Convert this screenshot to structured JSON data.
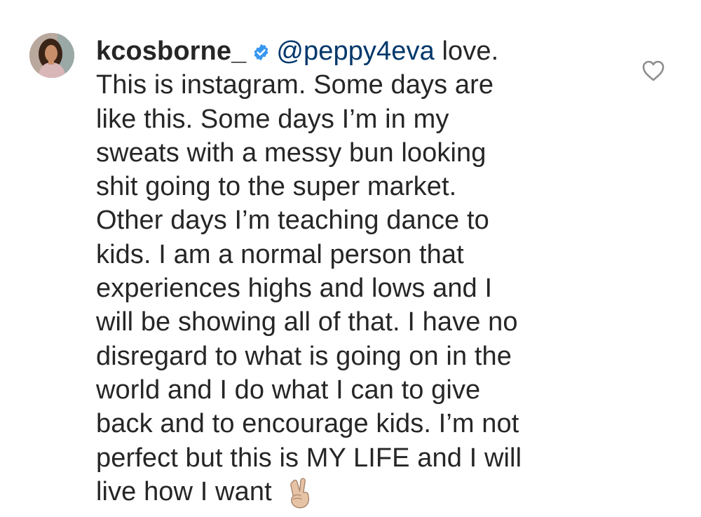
{
  "comment": {
    "avatar_icon": "profile-photo-avatar",
    "username": "kcosborne_",
    "verified_icon": "verified-badge-icon",
    "mention": "@peppy4eva",
    "first_line_rest": " love.",
    "lines": [
      "This is instagram. Some days are",
      "like this. Some days I’m in my",
      "sweats with a messy bun looking",
      "shit going to the super market.",
      "Other days I’m teaching dance to",
      "kids. I am a normal person that",
      "experiences highs and lows and I",
      "will be showing all of that. I have no",
      "disregard to what is going on in the",
      "world and I do what I can to give",
      "back and to encourage kids. I’m not",
      "perfect but this is MY LIFE and I will"
    ],
    "last_line": "live how I want",
    "emoji_icon": "victory-hand-emoji-icon",
    "like_icon": "heart-outline-icon"
  },
  "colors": {
    "text": "#262626",
    "mention": "#00376b",
    "verified": "#3897f0",
    "icon_gray": "#8e8e8e"
  }
}
